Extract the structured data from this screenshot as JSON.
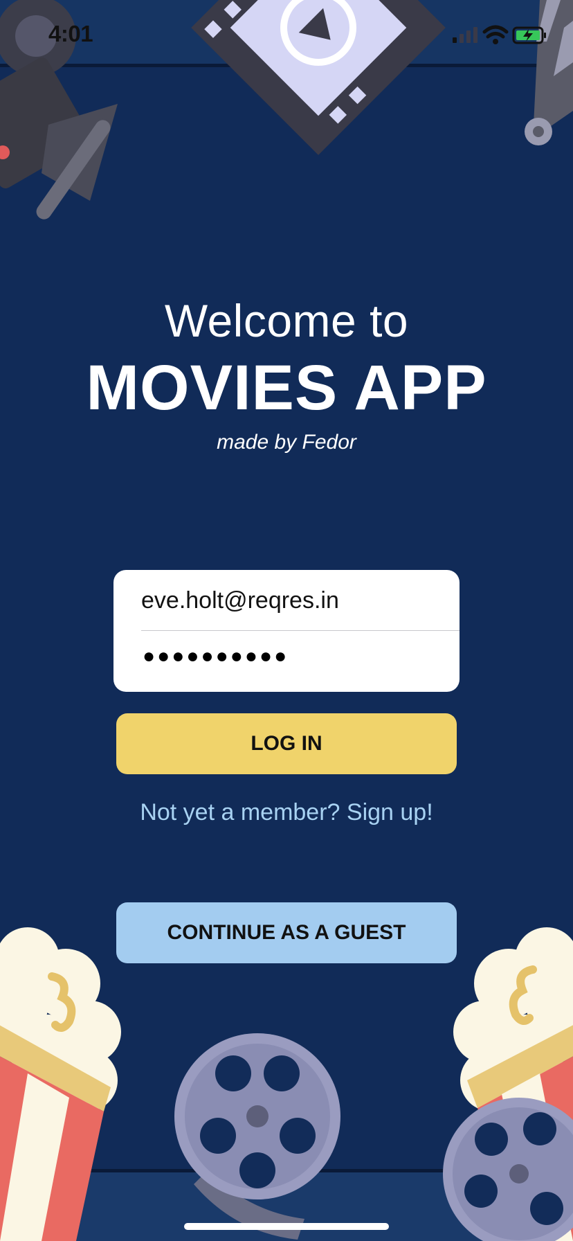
{
  "status_bar": {
    "time": "4:01"
  },
  "hero": {
    "welcome": "Welcome to",
    "title": "MOVIES APP",
    "subtitle": "made by Fedor"
  },
  "login_form": {
    "email_value": "eve.holt@reqres.in",
    "password_mask": "●●●●●●●●●●",
    "login_label": "LOG IN"
  },
  "signup_link": "Not yet a member? Sign up!",
  "guest_label": "CONTINUE AS A GUEST",
  "colors": {
    "background": "#112b58",
    "login_button": "#f0d36b",
    "guest_button": "#a3ccf0",
    "link": "#a8d2f2"
  },
  "icons": [
    "movie-camera-icon",
    "film-frame-icon",
    "clapperboard-icon",
    "popcorn-icon",
    "film-reel-icon",
    "signal-icon",
    "wifi-icon",
    "battery-icon"
  ]
}
